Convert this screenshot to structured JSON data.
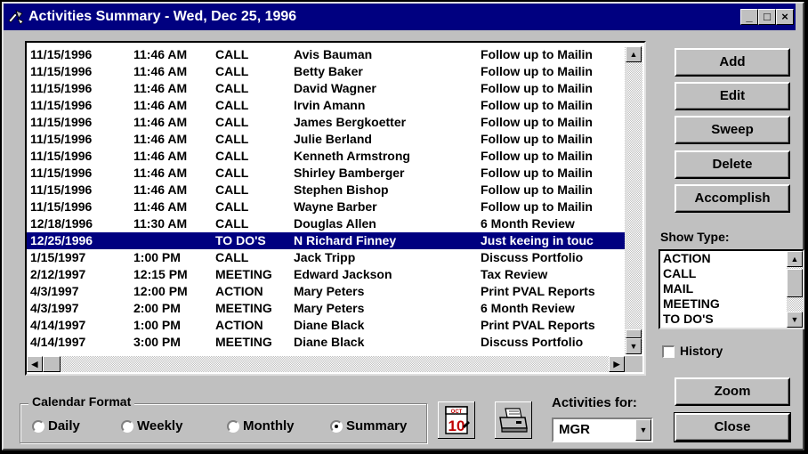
{
  "window": {
    "title": "Activities Summary - Wed, Dec 25, 1996",
    "minimize_glyph": "_",
    "maximize_glyph": "□",
    "close_glyph": "×"
  },
  "activities": [
    {
      "date": "11/15/1996",
      "time": "11:46 AM",
      "type": "CALL",
      "name": "Avis Bauman",
      "desc": "Follow up to Mailin"
    },
    {
      "date": "11/15/1996",
      "time": "11:46 AM",
      "type": "CALL",
      "name": "Betty Baker",
      "desc": "Follow up to Mailin"
    },
    {
      "date": "11/15/1996",
      "time": "11:46 AM",
      "type": "CALL",
      "name": "David Wagner",
      "desc": "Follow up to Mailin"
    },
    {
      "date": "11/15/1996",
      "time": "11:46 AM",
      "type": "CALL",
      "name": "Irvin Amann",
      "desc": "Follow up to Mailin"
    },
    {
      "date": "11/15/1996",
      "time": "11:46 AM",
      "type": "CALL",
      "name": "James Bergkoetter",
      "desc": "Follow up to Mailin"
    },
    {
      "date": "11/15/1996",
      "time": "11:46 AM",
      "type": "CALL",
      "name": "Julie Berland",
      "desc": "Follow up to Mailin"
    },
    {
      "date": "11/15/1996",
      "time": "11:46 AM",
      "type": "CALL",
      "name": "Kenneth Armstrong",
      "desc": "Follow up to Mailin"
    },
    {
      "date": "11/15/1996",
      "time": "11:46 AM",
      "type": "CALL",
      "name": "Shirley Bamberger",
      "desc": "Follow up to Mailin"
    },
    {
      "date": "11/15/1996",
      "time": "11:46 AM",
      "type": "CALL",
      "name": "Stephen Bishop",
      "desc": "Follow up to Mailin"
    },
    {
      "date": "11/15/1996",
      "time": "11:46 AM",
      "type": "CALL",
      "name": "Wayne Barber",
      "desc": "Follow up to Mailin"
    },
    {
      "date": "12/18/1996",
      "time": "11:30 AM",
      "type": "CALL",
      "name": "Douglas Allen",
      "desc": "6 Month Review"
    },
    {
      "date": "12/25/1996",
      "time": "",
      "type": "TO DO'S",
      "name": "N Richard Finney",
      "desc": "Just keeing in touc",
      "selected": true
    },
    {
      "date": "1/15/1997",
      "time": "1:00 PM",
      "type": "CALL",
      "name": "Jack Tripp",
      "desc": "Discuss Portfolio"
    },
    {
      "date": "2/12/1997",
      "time": "12:15 PM",
      "type": "MEETING",
      "name": "Edward Jackson",
      "desc": "Tax Review"
    },
    {
      "date": "4/3/1997",
      "time": "12:00 PM",
      "type": "ACTION",
      "name": "Mary Peters",
      "desc": "Print PVAL Reports"
    },
    {
      "date": "4/3/1997",
      "time": "2:00 PM",
      "type": "MEETING",
      "name": "Mary Peters",
      "desc": "6 Month Review"
    },
    {
      "date": "4/14/1997",
      "time": "1:00 PM",
      "type": "ACTION",
      "name": "Diane Black",
      "desc": "Print PVAL Reports"
    },
    {
      "date": "4/14/1997",
      "time": "3:00 PM",
      "type": "MEETING",
      "name": "Diane Black",
      "desc": "Discuss Portfolio"
    }
  ],
  "buttons": {
    "add": "Add",
    "edit": "Edit",
    "sweep": "Sweep",
    "delete": "Delete",
    "accomplish": "Accomplish",
    "zoom": "Zoom",
    "close": "Close"
  },
  "show_type": {
    "label": "Show Type:",
    "options": [
      "ACTION",
      "CALL",
      "MAIL",
      "MEETING",
      "TO DO'S"
    ]
  },
  "history": {
    "label": "History",
    "checked": false
  },
  "calendar_format": {
    "title": "Calendar Format",
    "options": [
      "Daily",
      "Weekly",
      "Monthly",
      "Summary"
    ],
    "selected": "Summary"
  },
  "calendar_icon": {
    "month": "OCT",
    "day": "10"
  },
  "activities_for": {
    "label": "Activities for:",
    "value": "MGR"
  }
}
